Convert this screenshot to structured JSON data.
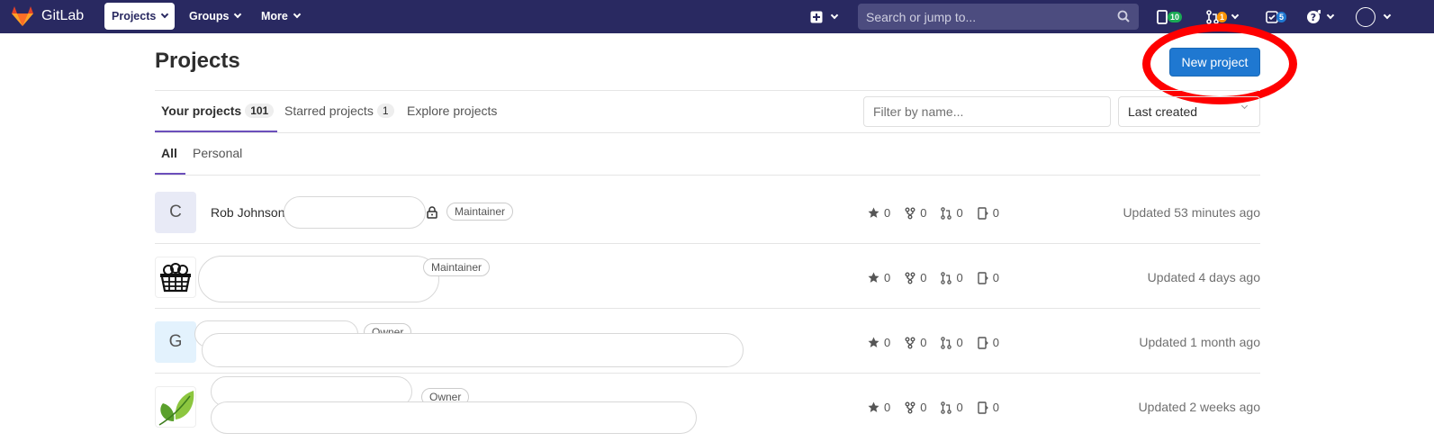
{
  "nav": {
    "brand": "GitLab",
    "projects": "Projects",
    "groups": "Groups",
    "more": "More",
    "search_placeholder": "Search or jump to...",
    "issues_count": "10",
    "mr_count": "1",
    "todos_count": "5",
    "issues_color": "#1aaa55",
    "mr_color": "#fc9403",
    "todos_color": "#1f78d1"
  },
  "page": {
    "title": "Projects",
    "new_project": "New project"
  },
  "tabs": [
    {
      "label": "Your projects",
      "count": "101"
    },
    {
      "label": "Starred projects",
      "count": "1"
    },
    {
      "label": "Explore projects"
    }
  ],
  "filter": {
    "placeholder": "Filter by name...",
    "sort": "Last created"
  },
  "subtabs": [
    "All",
    "Personal"
  ],
  "projects": [
    {
      "letter": "C",
      "name": "Rob Johnson",
      "role": "Maintainer",
      "stars": "0",
      "forks": "0",
      "mrs": "0",
      "issues": "0",
      "updated": "Updated 53 minutes ago"
    },
    {
      "letter": "",
      "name": "",
      "role": "Maintainer",
      "stars": "0",
      "forks": "0",
      "mrs": "0",
      "issues": "0",
      "updated": "Updated 4 days ago"
    },
    {
      "letter": "G",
      "name": "",
      "role": "Owner",
      "stars": "0",
      "forks": "0",
      "mrs": "0",
      "issues": "0",
      "updated": "Updated 1 month ago"
    },
    {
      "letter": "",
      "name": "",
      "role": "Owner",
      "stars": "0",
      "forks": "0",
      "mrs": "0",
      "issues": "0",
      "updated": "Updated 2 weeks ago"
    }
  ]
}
